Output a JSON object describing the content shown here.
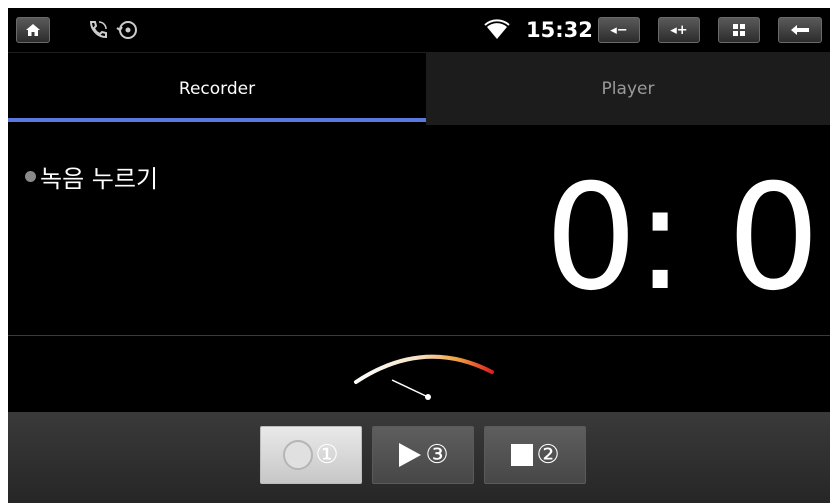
{
  "statusbar": {
    "time": "15:32",
    "home_icon": "home-icon",
    "phone_icon": "phone-call-icon",
    "sync_icon": "sync-icon",
    "wifi_icon": "wifi-icon",
    "vol_down_label": "◂−",
    "vol_up_label": "◂+",
    "grid_icon": "grid-icon",
    "back_icon": "back-arrow-icon"
  },
  "tabs": [
    {
      "label": "Recorder",
      "active": true
    },
    {
      "label": "Player",
      "active": false
    }
  ],
  "recorder": {
    "status_text": "녹음 누르기",
    "timer": "0: 0"
  },
  "controls": {
    "record": {
      "label": "①",
      "icon": "record-icon"
    },
    "play": {
      "label": "③",
      "icon": "play-icon"
    },
    "stop": {
      "label": "②",
      "icon": "stop-icon"
    }
  },
  "colors": {
    "tab_indicator": "#5a78e0",
    "meter_start": "#ffffff",
    "meter_end": "#e02020"
  }
}
